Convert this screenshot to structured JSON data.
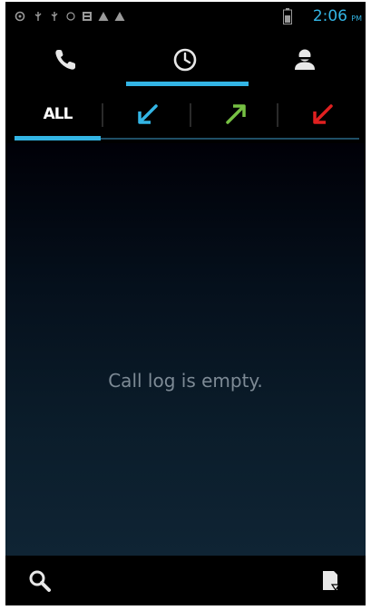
{
  "status_bar": {
    "time": "2:06",
    "ampm": "PM",
    "colors": {
      "accent": "#33b5e5",
      "icon": "#9a9a9a"
    },
    "icons": [
      "settings-icon",
      "usb-icon",
      "usb-icon",
      "signal-icon",
      "image-icon",
      "warning-icon",
      "warning-icon",
      "battery-icon"
    ]
  },
  "main_tabs": [
    {
      "name": "phone",
      "icon": "phone-icon",
      "selected": false
    },
    {
      "name": "call_log",
      "icon": "clock-icon",
      "selected": true
    },
    {
      "name": "contacts",
      "icon": "contacts-icon",
      "selected": false
    }
  ],
  "filter_tabs": {
    "all_label": "ALL",
    "items": [
      {
        "name": "all",
        "selected": true
      },
      {
        "name": "incoming",
        "icon": "incoming-arrow-icon",
        "color": "#33b5e5"
      },
      {
        "name": "outgoing",
        "icon": "outgoing-arrow-icon",
        "color": "#76c043"
      },
      {
        "name": "missed",
        "icon": "missed-arrow-icon",
        "color": "#e02020"
      }
    ]
  },
  "content": {
    "empty_message": "Call log is empty."
  },
  "bottom_bar": {
    "left_icon": "search-icon",
    "right_icon": "menu-icon"
  }
}
